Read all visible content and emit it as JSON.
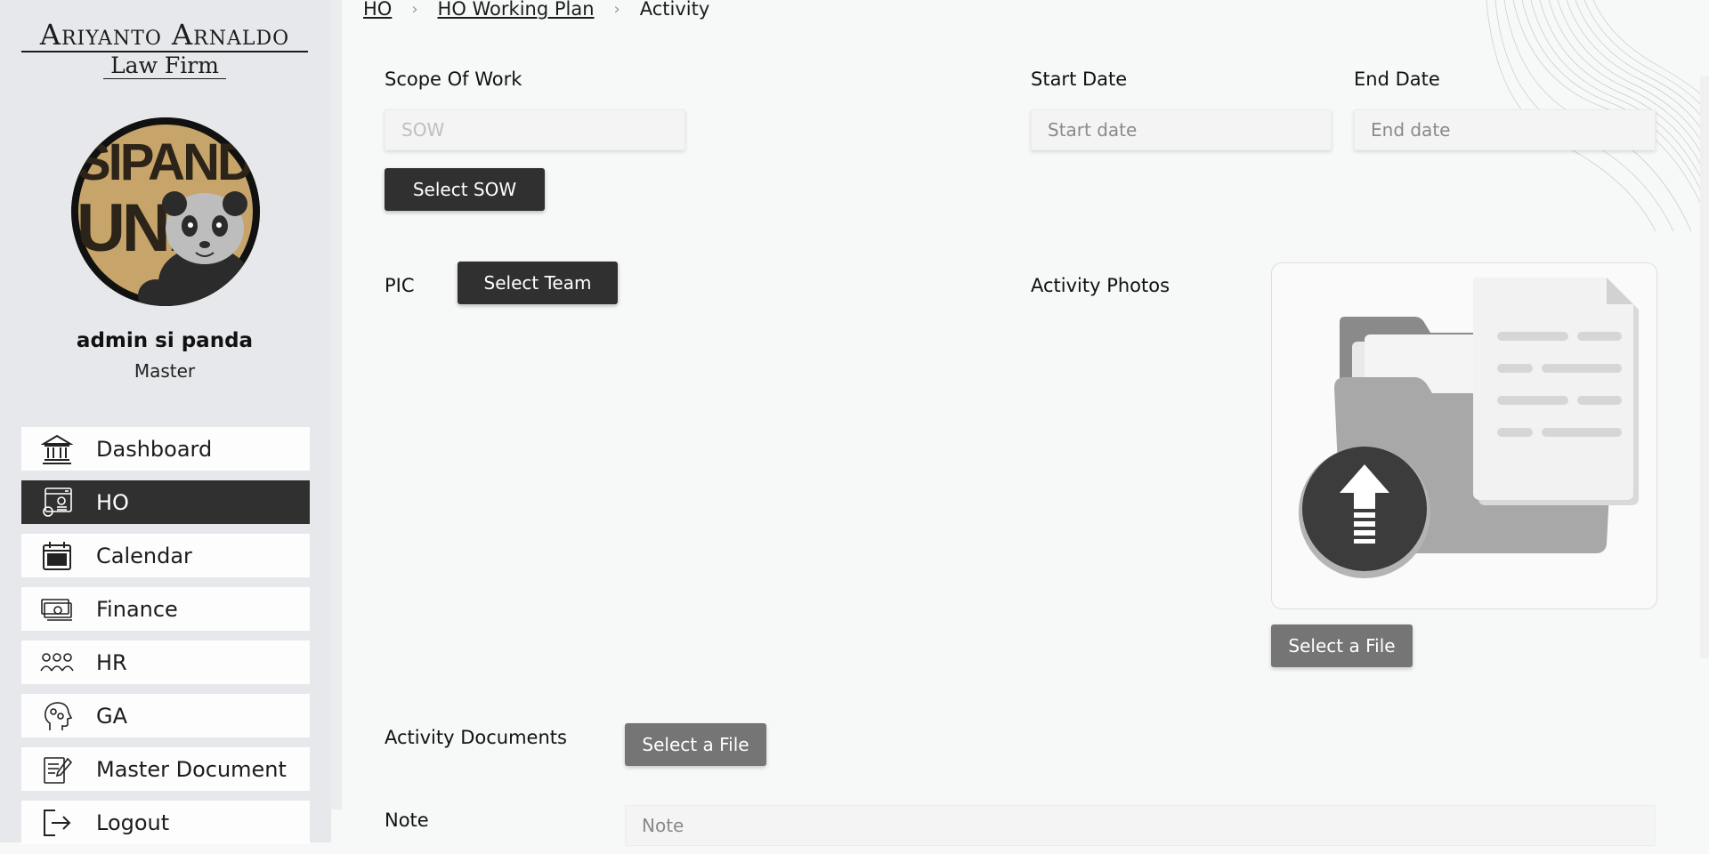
{
  "brand": {
    "line1": "Ariyanto Arnaldo",
    "line2": "Law Firm"
  },
  "user": {
    "name": "admin si panda",
    "role": "Master",
    "avatar_text": "SIPANDA UNIK"
  },
  "nav": {
    "items": [
      {
        "label": "Dashboard",
        "icon": "bank-icon"
      },
      {
        "label": "HO",
        "icon": "office-settings-icon"
      },
      {
        "label": "Calendar",
        "icon": "calendar-icon"
      },
      {
        "label": "Finance",
        "icon": "money-icon"
      },
      {
        "label": "HR",
        "icon": "team-icon"
      },
      {
        "label": "GA",
        "icon": "head-gears-icon"
      },
      {
        "label": "Master Document",
        "icon": "document-edit-icon"
      },
      {
        "label": "Logout",
        "icon": "logout-icon"
      }
    ],
    "active": "HO"
  },
  "breadcrumb": {
    "items": [
      "HO",
      "HO Working Plan"
    ],
    "current": "Activity",
    "separator": "›"
  },
  "form": {
    "sow": {
      "label": "Scope Of Work",
      "placeholder": "SOW",
      "button": "Select SOW"
    },
    "start_date": {
      "label": "Start Date",
      "placeholder": "Start date"
    },
    "end_date": {
      "label": "End Date",
      "placeholder": "End date"
    },
    "pic": {
      "label": "PIC",
      "button": "Select Team"
    },
    "photos": {
      "label": "Activity Photos",
      "button": "Select a File"
    },
    "documents": {
      "label": "Activity Documents",
      "button": "Select a File"
    },
    "note": {
      "label": "Note",
      "placeholder": "Note"
    }
  },
  "colors": {
    "sidebar_bg": "#e7e8eb",
    "active_nav": "#303030",
    "dark_button": "#303030",
    "grey_button": "#757575",
    "page_bg": "#f7f8f8"
  }
}
